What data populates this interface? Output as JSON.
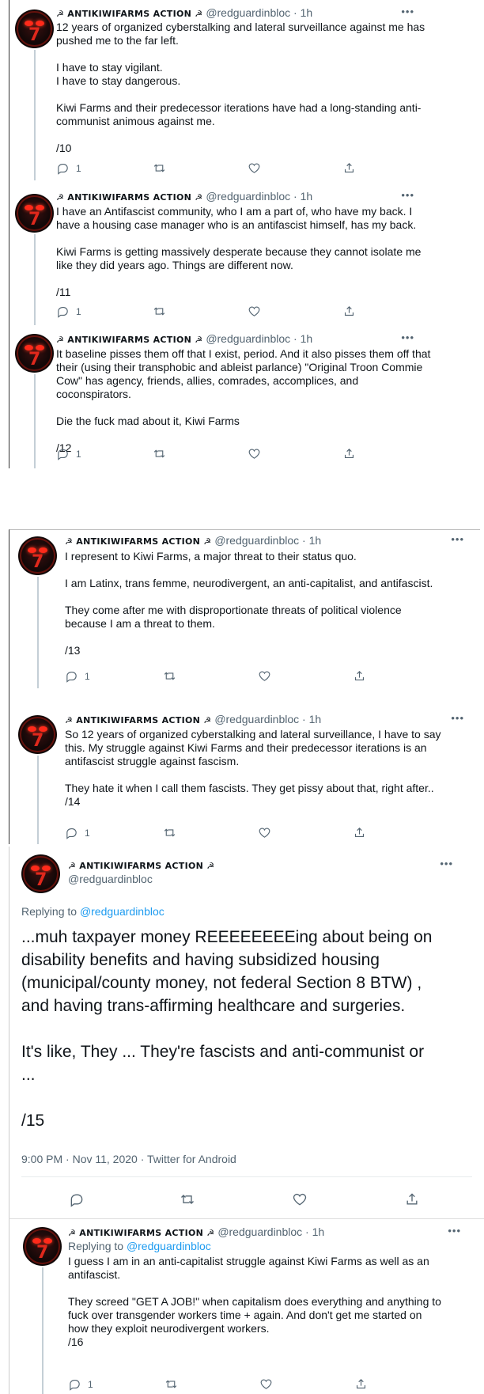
{
  "account": {
    "name": "☭ ANTIKIWIFARMS ACTION ☭",
    "handle": "@redguardinbloc",
    "time": "· 1h",
    "replying_label": "Replying to",
    "replying_handle": "@redguardinbloc"
  },
  "tweets": [
    {
      "body": "12 years of organized cyberstalking and lateral surveillance against me has\npushed me to the far left.\n\nI have to stay vigilant.\nI have to stay dangerous.\n\nKiwi Farms and their predecessor iterations have had a long-standing anti-\ncommunist animous against me.\n\n/10",
      "reply_count": "1"
    },
    {
      "body": "I have an Antifascist community, who I am a part of, who have my back. I\nhave a housing case manager who is an antifascist himself, has my back.\n\nKiwi Farms is getting massively desperate because they cannot isolate me\nlike they did years ago. Things are different now.\n\n/11",
      "reply_count": "1"
    },
    {
      "body": "It baseline pisses them off that I exist, period. And it also pisses them off that\ntheir (using their transphobic and ableist parlance) \"Original Troon Commie\nCow\" has agency, friends, allies, comrades, accomplices, and coconspirators.\n\nDie the fuck mad about it, Kiwi Farms\n\n/12",
      "reply_count": "1"
    },
    {
      "body": "I represent to Kiwi Farms, a major threat to their status quo.\n\nI am Latinx, trans femme, neurodivergent, an anti-capitalist, and antifascist.\n\nThey come after me with disproportionate threats of political violence\nbecause I am a threat to them.\n\n/13",
      "reply_count": "1"
    },
    {
      "body": "So 12 years of organized cyberstalking and lateral surveillance, I have to say\nthis. My struggle against Kiwi Farms and their predecessor iterations is an\nantifascist struggle against fascism.\n\nThey hate it when I call them fascists. They get pissy about that, right after..\n/14",
      "reply_count": "1"
    },
    {
      "body": "I guess I am in an anti-capitalist struggle against Kiwi Farms as well as an\nantifascist.\n\nThey screed \"GET A JOB!\" when capitalism does everything and anything to\nfuck over transgender workers time + again. And don't get me started on\nhow they exploit neurodivergent workers.\n/16",
      "reply_count": "1"
    }
  ],
  "main_tweet": {
    "body": "...muh taxpayer money REEEEEEEEing about being on\ndisability benefits and having subsidized housing\n(municipal/county money, not federal Section 8 BTW) ,\nand having trans-affirming healthcare and surgeries.\n\nIt's like, They ... They're fascists and anti-communist or\n...\n\n/15",
    "meta": "9:00 PM · Nov 11, 2020 · Twitter for Android"
  },
  "icons": {
    "reply": "reply-icon",
    "retweet": "retweet-icon",
    "like": "heart-icon",
    "share": "share-icon",
    "more": "more-icon",
    "accent": "#1d9bf0"
  }
}
